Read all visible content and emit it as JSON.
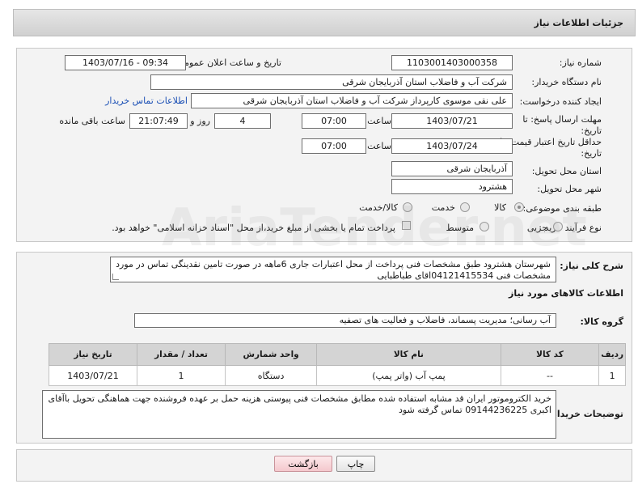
{
  "header": {
    "title": "جزئیات اطلاعات نیاز"
  },
  "form": {
    "need_number_label": "شماره نیاز:",
    "need_number": "1103001403000358",
    "announce_label": "تاریخ و ساعت اعلان عمومی:",
    "announce_value": "1403/07/16 - 09:34",
    "buyer_org_label": "نام دستگاه خریدار:",
    "buyer_org": "شرکت آب و فاضلاب استان آذربایجان شرقی",
    "requester_label": "ایجاد کننده درخواست:",
    "requester": "علی نقی موسوی کارپرداز شرکت آب و فاضلاب استان آذربایجان شرقی",
    "contact_link": "اطلاعات تماس خریدار",
    "deadline_label_1": "مهلت ارسال پاسخ: تا",
    "deadline_label_2": "تاریخ:",
    "deadline_date": "1403/07/21",
    "time_label": "ساعت",
    "deadline_time": "07:00",
    "days_value": "4",
    "days_label": "روز و",
    "remaining_time": "21:07:49",
    "remaining_label": "ساعت باقی مانده",
    "validity_label_1": "حداقل تاریخ اعتبار قیمت: تا",
    "validity_label_2": "تاریخ:",
    "validity_date": "1403/07/24",
    "validity_time_label": "ساعت",
    "validity_time": "07:00",
    "province_label": "استان محل تحویل:",
    "province": "آذربایجان شرقی",
    "city_label": "شهر محل تحویل:",
    "city": "هشترود",
    "category_label": "طبقه بندی موضوعی:",
    "category_options": [
      "کالا",
      "خدمت",
      "کالا/خدمت"
    ],
    "process_label": "نوع فرآیند خرید :",
    "process_options": [
      "جزیی",
      "متوسط"
    ],
    "payment_note": "پرداخت تمام یا بخشی از مبلغ خرید،از محل \"اسناد خزانه اسلامی\" خواهد بود."
  },
  "description": {
    "label": "شرح کلی نیاز:",
    "text": "شهرستان هشترود طبق مشخصات فنی پرداخت از محل اعتبارات جاری     6ماهه در صورت تامین نقدینگی تماس در مورد مشخصات فنی 04121415534اقای  طباطبایی"
  },
  "goods_info_title": "اطلاعات کالاهای مورد نیاز",
  "goods_group": {
    "label": "گروه کالا:",
    "value": "آب رسانی؛ مدیریت پسماند، فاضلاب و فعالیت های تصفیه"
  },
  "table": {
    "headers": [
      "ردیف",
      "کد کالا",
      "نام کالا",
      "واحد شمارش",
      "تعداد / مقدار",
      "تاریخ نیاز"
    ],
    "rows": [
      [
        "1",
        "--",
        "پمپ آب (واتر پمپ)",
        "دستگاه",
        "1",
        "1403/07/21"
      ]
    ]
  },
  "buyer_notes": {
    "label": "توضیحات خریدار:",
    "text": "خرید الکتروموتور ایران قد مشابه استفاده شده مطابق مشخصات فنی پیوستی  هزینه حمل بر عهده فروشنده جهت هماهنگی تحویل باآقای اکبری 09144236225 تماس گرفته شود"
  },
  "buttons": {
    "print": "چاپ",
    "back": "بازگشت"
  },
  "watermark": "AriaTender.net"
}
